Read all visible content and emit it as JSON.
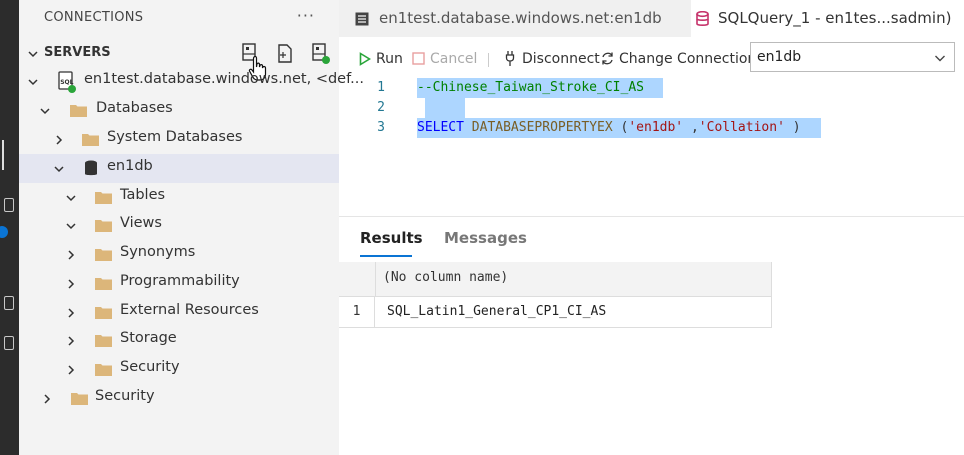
{
  "sidebar": {
    "header": "CONNECTIONS",
    "more": "···",
    "servers_label": "SERVERS",
    "tree": [
      {
        "label": "en1test.database.windows.net, <def...",
        "kind": "server"
      },
      {
        "label": "Databases",
        "kind": "folder"
      },
      {
        "label": "System Databases",
        "kind": "folder"
      },
      {
        "label": "en1db",
        "kind": "database"
      },
      {
        "label": "Tables",
        "kind": "folder"
      },
      {
        "label": "Views",
        "kind": "folder"
      },
      {
        "label": "Synonyms",
        "kind": "folder"
      },
      {
        "label": "Programmability",
        "kind": "folder"
      },
      {
        "label": "External Resources",
        "kind": "folder"
      },
      {
        "label": "Storage",
        "kind": "folder"
      },
      {
        "label": "Security",
        "kind": "folder"
      },
      {
        "label": "Security",
        "kind": "folder"
      }
    ]
  },
  "tabs": [
    {
      "label": "en1test.database.windows.net:en1db",
      "icon": "list-icon"
    },
    {
      "label": "SQLQuery_1 - en1tes...sadmin)",
      "icon": "database-icon"
    }
  ],
  "toolbar": {
    "run": "Run",
    "cancel": "Cancel",
    "disconnect": "Disconnect",
    "change_connection": "Change Connection",
    "database": "en1db"
  },
  "editor": {
    "line_numbers": [
      "1",
      "2",
      "3"
    ],
    "line1": "--Chinese_Taiwan_Stroke_CI_AS",
    "line3": {
      "kw": "SELECT",
      "fn": "DATABASEPROPERTYEX",
      "open": " (",
      "arg1": "'en1db'",
      "comma": " ,",
      "arg2": "'Collation'",
      "close": " )"
    }
  },
  "results": {
    "tabs": [
      "Results",
      "Messages"
    ],
    "column": "(No column name)",
    "rows": [
      {
        "num": "1",
        "value": "SQL_Latin1_General_CP1_CI_AS"
      }
    ]
  },
  "colors": {
    "accent": "#0a74d4",
    "selection": "#add6ff",
    "status_green": "#2aa53a",
    "folder": "#dcb67a"
  }
}
